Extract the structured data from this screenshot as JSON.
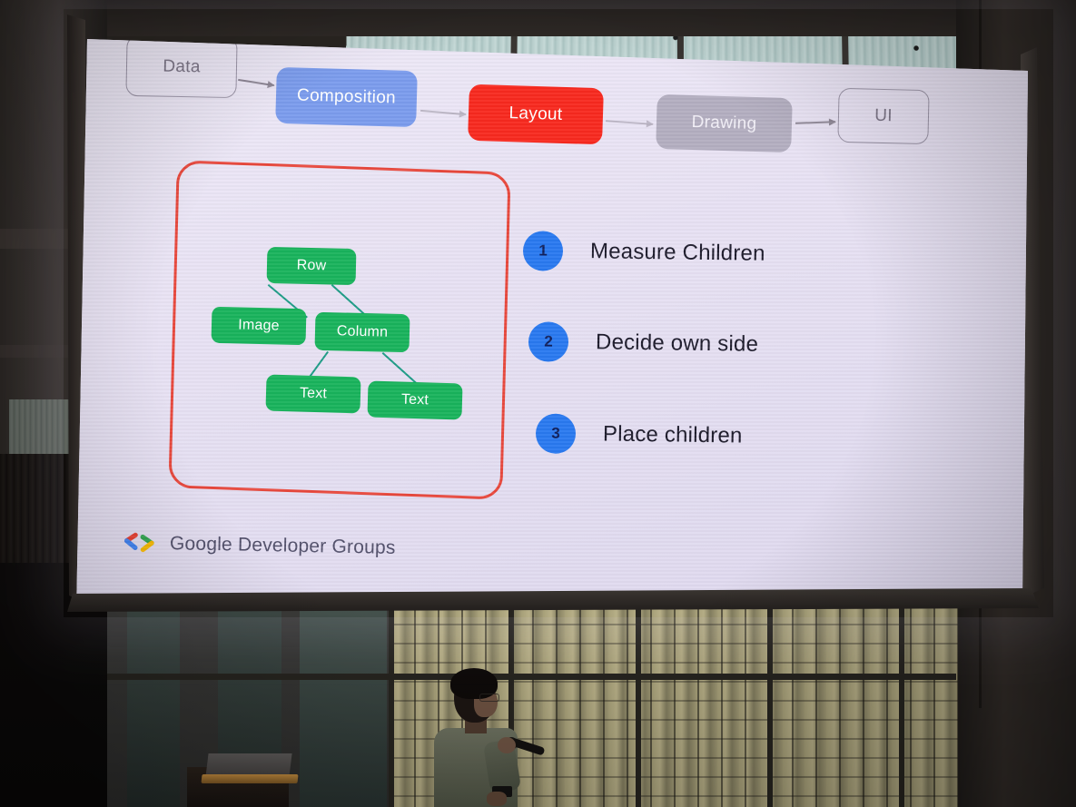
{
  "scene": {
    "description": "Conference talk slide projected on a large screen",
    "presenter_visible": true
  },
  "slide": {
    "pipeline": {
      "nodes": [
        {
          "id": "data",
          "label": "Data",
          "style": "outline",
          "color": "#9a93a6"
        },
        {
          "id": "composition",
          "label": "Composition",
          "style": "filled",
          "color": "#7b9ced"
        },
        {
          "id": "layout",
          "label": "Layout",
          "style": "filled",
          "color": "#f8291f"
        },
        {
          "id": "drawing",
          "label": "Drawing",
          "style": "filled",
          "color": "#b3aec0"
        },
        {
          "id": "ui",
          "label": "UI",
          "style": "outline",
          "color": "#9a93a6"
        }
      ],
      "arrow_color": "#8e8796"
    },
    "highlight_box": {
      "color": "#e8483c"
    },
    "tree": {
      "node_color": "#19b35c",
      "edge_color": "#1d9c86",
      "nodes": [
        {
          "id": "row",
          "label": "Row"
        },
        {
          "id": "image",
          "label": "Image"
        },
        {
          "id": "col",
          "label": "Column"
        },
        {
          "id": "text1",
          "label": "Text"
        },
        {
          "id": "text2",
          "label": "Text"
        }
      ],
      "edges": [
        {
          "from": "row",
          "to": "image"
        },
        {
          "from": "row",
          "to": "col"
        },
        {
          "from": "col",
          "to": "text1"
        },
        {
          "from": "col",
          "to": "text2"
        }
      ]
    },
    "steps": {
      "bullet_color": "#2979f0",
      "items": [
        {
          "number": "1",
          "label": "Measure Children"
        },
        {
          "number": "2",
          "label": "Decide own side"
        },
        {
          "number": "3",
          "label": "Place children"
        }
      ]
    },
    "footer": {
      "logo_name": "google-developer-groups-logo",
      "text": "Google Developer Groups",
      "logo_colors": {
        "blue": "#4285f4",
        "red": "#ea4335",
        "yellow": "#fbbc04",
        "green": "#34a853"
      }
    },
    "background_color": "#e7e1f3"
  }
}
